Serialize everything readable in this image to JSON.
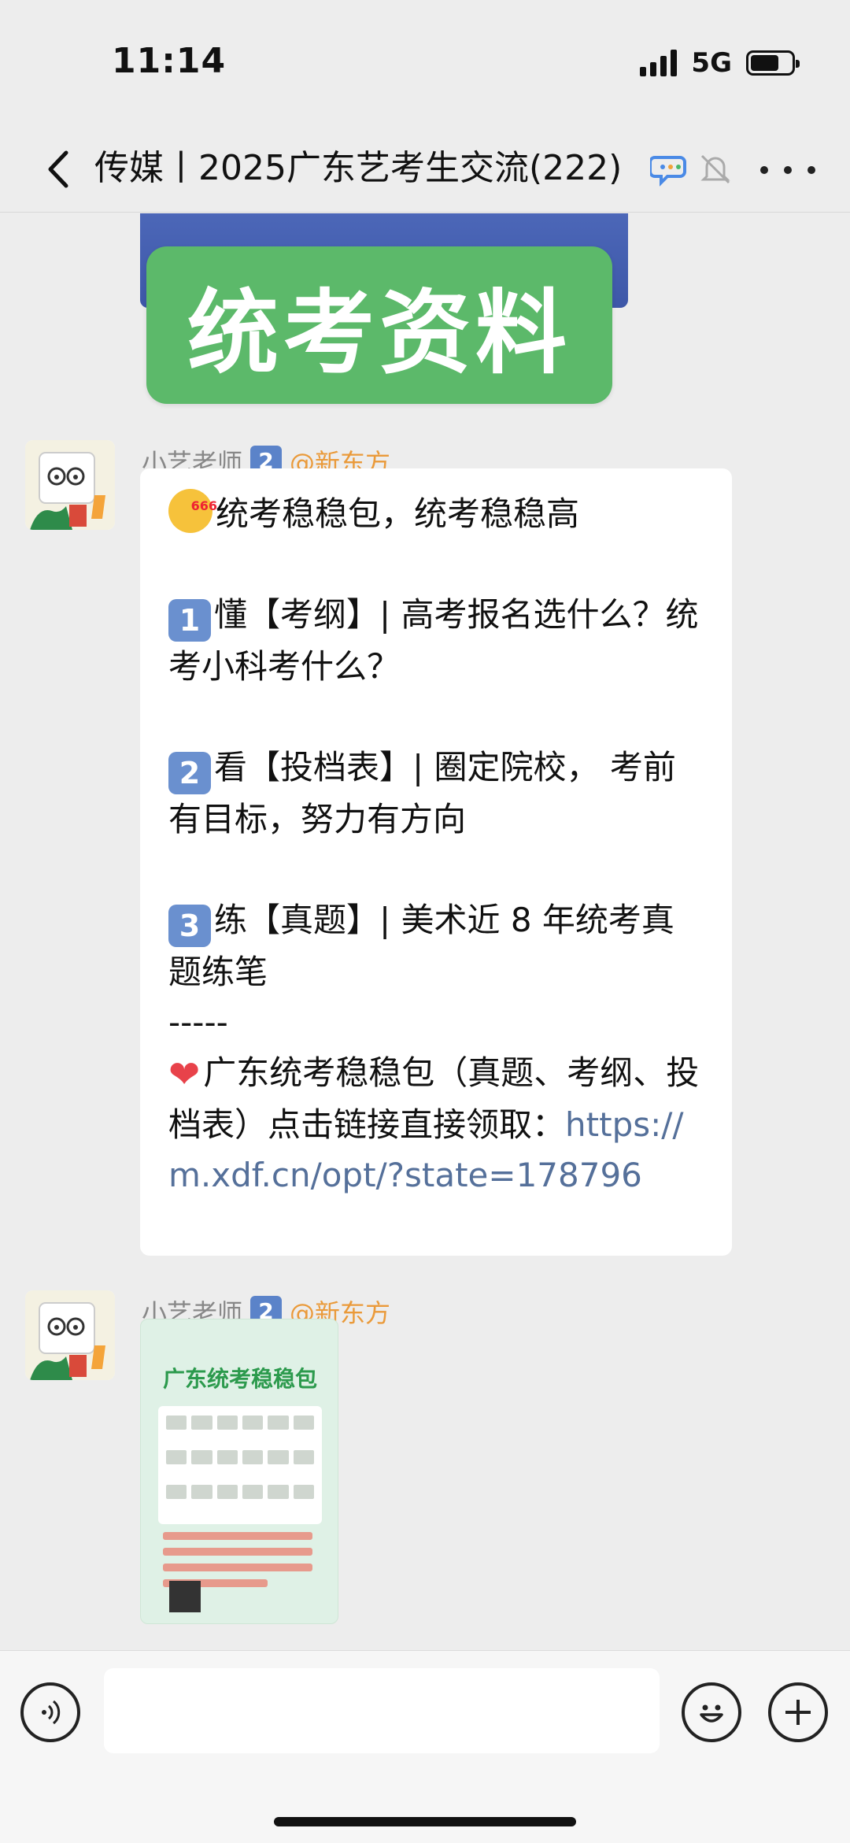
{
  "status_bar": {
    "time": "11:14",
    "network": "5G"
  },
  "nav": {
    "title": "传媒丨2025广东艺考生交流(222)",
    "icons": [
      "back-icon",
      "group-chat-icon",
      "mute-icon",
      "more-icon"
    ]
  },
  "top_banner": {
    "text": "统考资料"
  },
  "messages": [
    {
      "sender": "小艺老师",
      "badge": "2",
      "org": "@新东方",
      "lines": {
        "l1": "统考稳稳包，统考稳稳高",
        "b1": "1",
        "l2": "懂【考纲】| 高考报名选什么？统考小科考什么？",
        "b2": "2",
        "l3": "看【投档表】| 圈定院校， 考前有目标，努力有方向",
        "b3": "3",
        "l4": "练【真题】| 美术近 8 年统考真题练笔",
        "sep": "-----",
        "l5": "广东统考稳稳包（真题、考纲、投档表）点击链接直接领取：",
        "link": "https://m.xdf.cn/opt/?state=178796"
      }
    },
    {
      "sender": "小艺老师",
      "badge": "2",
      "org": "@新东方",
      "image_title": "广东统考稳稳包"
    }
  ],
  "colors": {
    "background": "#ededed",
    "banner_green": "#5cb96a",
    "link": "#55709a",
    "org": "#ea9a3a",
    "badge": "#6a90cf"
  }
}
